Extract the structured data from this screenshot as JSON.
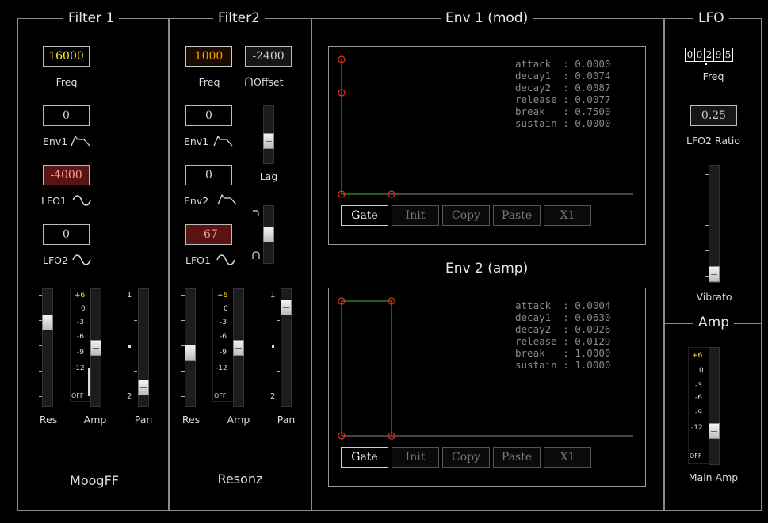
{
  "sections": {
    "filter1": "Filter 1",
    "filter2": "Filter2",
    "env1": "Env 1 (mod)",
    "lfo": "LFO",
    "env2": "Env 2 (amp)",
    "amp": "Amp"
  },
  "filter1": {
    "freq_value": "16000",
    "freq_label": "Freq",
    "env1_value": "0",
    "env1_label": "Env1",
    "lfo1_value": "-4000",
    "lfo1_label": "LFO1",
    "lfo2_value": "0",
    "lfo2_label": "LFO2",
    "res_label": "Res",
    "res_level": 0.75,
    "amp_label": "Amp",
    "amp_level_db": -6,
    "pan_label": "Pan",
    "pan_level": 0.1,
    "pan_top": "1",
    "pan_bottom": "2",
    "filter_type": "MoogFF"
  },
  "filter2": {
    "freq_value": "1000",
    "freq_label": "Freq",
    "offset_value": "-2400",
    "offset_label": "Offset",
    "env1_value": "0",
    "env1_label": "Env1",
    "lag_label": "Lag",
    "lag_level": 0.35,
    "env2_value": "0",
    "env2_label": "Env2",
    "mix_level": 0.5,
    "lfo1_value": "-67",
    "lfo1_label": "LFO1",
    "res_label": "Res",
    "res_level": 0.45,
    "amp_label": "Amp",
    "amp_level_db": -6,
    "pan_label": "Pan",
    "pan_level": 0.9,
    "pan_top": "1",
    "pan_bottom": "2",
    "filter_type": "Resonz"
  },
  "db_scale": [
    "+6",
    "0",
    "-3",
    "-6",
    "-9",
    "-12",
    "OFF"
  ],
  "env1": {
    "readout": "attack  : 0.0000\ndecay1  : 0.0074\ndecay2  : 0.0087\nrelease : 0.0077\nbreak   : 0.7500\nsustain : 0.0000",
    "buttons": [
      "Gate",
      "Init",
      "Copy",
      "Paste",
      "X1"
    ]
  },
  "env2": {
    "readout": "attack  : 0.0004\ndecay1  : 0.0630\ndecay2  : 0.0926\nrelease : 0.0129\nbreak   : 1.0000\nsustain : 1.0000",
    "buttons": [
      "Gate",
      "Init",
      "Copy",
      "Paste",
      "X1"
    ]
  },
  "lfo": {
    "freq_digits": [
      "0",
      "0",
      "2",
      "9",
      "5"
    ],
    "freq_label": "Freq",
    "lfo2_ratio_value": "0.25",
    "lfo2_ratio_label": "LFO2 Ratio",
    "vibrato_label": "Vibrato",
    "vibrato_level": 0.0
  },
  "amp": {
    "main_amp_label": "Main Amp",
    "main_amp_level_db": -12
  },
  "colors": {
    "env_line": "#2e9a2e",
    "env_point": "#e0302a",
    "freq_text": "#ffeb3b",
    "filter2_freq_text": "#ff9800",
    "lfo_box_bg": "#5a1414"
  }
}
